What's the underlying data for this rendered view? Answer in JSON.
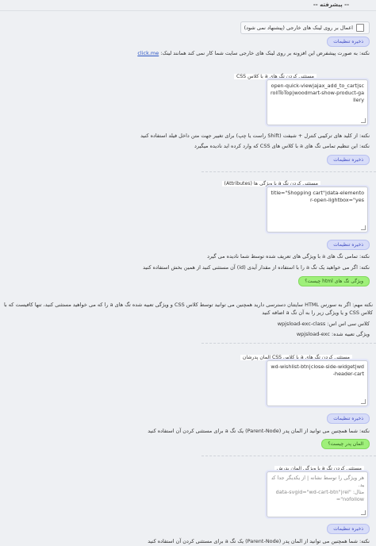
{
  "section": {
    "title": "-- پیشرفته --"
  },
  "external_links": {
    "checkbox_label": "اعمال بر روی لینک های خارجی (پیشنهاد نمی شود)",
    "checked": false,
    "save_label": "ذخیره تنظیمات",
    "note_text": "نکته: به صورت پیشفرض این افزونه بر روی لینک های خارجی سایت شما کار نمی کند همانند لینک:",
    "note_link": "click.me"
  },
  "css_class_block": {
    "title": "مستثنی کردن تگ های a با کلاس CSS",
    "value": "open-quick-view|ajax_add_to_cart|scrollToTop|woodmart-show-product-gallery",
    "note1": "نکته: از کلید های ترکیبی کنترل + شیفت (Shift راست یا چپ) برای تغییر جهت متن داخل فیلد استفاده کنید",
    "note2": "نکته: این تنظیم تمامی تگ های a با کلاس های CSS که وارد کرده اید نادیده میگیرد",
    "save_label": "ذخیره تنظیمات"
  },
  "attributes_block": {
    "title": "مستثنی کردن تگ a با ویژگی ها (Attributes)",
    "value": "title=\"Shopping cart\"|data-elementor-open-lightbox=\"yes",
    "save_label": "ذخیره تنظیمات",
    "note1": "نکته: تمامی تگ های a با ویژگی های تعریف شده توسط شما نادیده می گیرد",
    "note2": "نکته: اگر می خواهید یک تگ a را با استفاده از مقدار آیدی (id) آن مستثنی کنید از همین بخش استفاده کنید",
    "green_label": "ویژگی تگ های html چیست؟"
  },
  "html_note": {
    "line1": "نکته مهم: اگر به سورس HTML سایتتان دسترسی دارید همچنین می توانید توسط کلاس CSS و ویژگی تعبیه شده تگ های a را که می خواهید مستثنی کنید، تنها کافیست که با کلاس CSS و یا ویژگی زیر را به آن تگ a اضافه کنید",
    "class_label": "کلاس سی اس اس:",
    "class_value": "wpjsload-exc-class",
    "attr_label": "ویژگی تعبیه شده:",
    "attr_value": "wpjsload-exc"
  },
  "parent_class_block": {
    "title": "مستثنی کردن تگ های a با کلاس CSS المان پدرشان",
    "value": "wd-wishlist-btn|close-side-widget|wd-header-cart",
    "save_label": "ذخیره تنظیمات",
    "note": "نکته: شما همچنین می توانید از المان پدر (Parent-Node) یک تگ a برای مستثنی کردن آن استفاده کنید",
    "green_label": "المان پدر چیست؟"
  },
  "parent_attr_block": {
    "title": "مستثنی کردن تگ a با ویژگی المان پدرش",
    "placeholder_line1": "هر ویژگی را توسط نشانه | از یکدیگر جدا کنید.",
    "placeholder_line2": "مثال: \"data-svgid=\"wd-cart-btn\"|rel=\"nofollow",
    "save_label": "ذخیره تنظیمات",
    "note": "نکته: شما همچنین می توانید از المان پدر (Parent-Node) یک تگ a برای مستثنی کردن آن استفاده کنید"
  }
}
